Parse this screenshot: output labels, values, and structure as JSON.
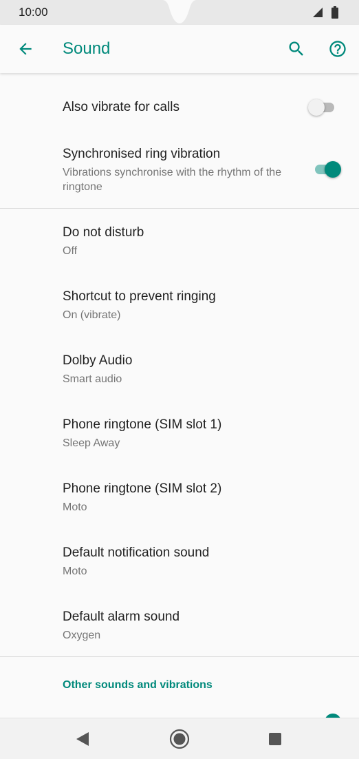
{
  "status_bar": {
    "time": "10:00",
    "icons": [
      "signal-icon",
      "battery-icon"
    ]
  },
  "app_bar": {
    "title": "Sound",
    "icons": [
      "back-arrow-icon",
      "search-icon",
      "help-icon"
    ]
  },
  "colors": {
    "accent": "#00897b",
    "primary_text": "#212121",
    "secondary_text": "#757575"
  },
  "settings": {
    "vibrate_for_calls": {
      "title": "Also vibrate for calls",
      "enabled": false
    },
    "sync_ring_vibration": {
      "title": "Synchronised ring vibration",
      "summary": "Vibrations synchronise with the rhythm of the ringtone",
      "enabled": true
    },
    "items": [
      {
        "title": "Do not disturb",
        "summary": "Off"
      },
      {
        "title": "Shortcut to prevent ringing",
        "summary": "On (vibrate)"
      },
      {
        "title": "Dolby Audio",
        "summary": "Smart audio"
      },
      {
        "title": "Phone ringtone (SIM slot 1)",
        "summary": "Sleep Away"
      },
      {
        "title": "Phone ringtone (SIM slot 2)",
        "summary": "Moto"
      },
      {
        "title": "Default notification sound",
        "summary": "Moto"
      },
      {
        "title": "Default alarm sound",
        "summary": "Oxygen"
      }
    ],
    "section_header": "Other sounds and vibrations"
  },
  "nav_bar": {
    "icons": [
      "back-triangle-icon",
      "home-circle-icon",
      "recents-square-icon"
    ]
  }
}
